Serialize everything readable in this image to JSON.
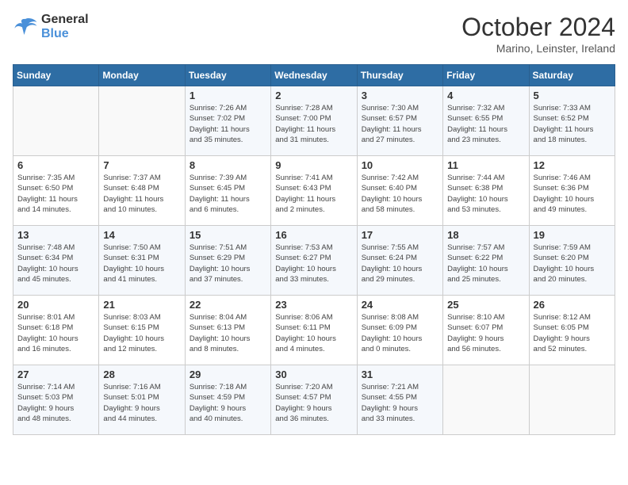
{
  "header": {
    "logo_line1": "General",
    "logo_line2": "Blue",
    "month": "October 2024",
    "location": "Marino, Leinster, Ireland"
  },
  "columns": [
    "Sunday",
    "Monday",
    "Tuesday",
    "Wednesday",
    "Thursday",
    "Friday",
    "Saturday"
  ],
  "rows": [
    [
      {
        "day": "",
        "info": ""
      },
      {
        "day": "",
        "info": ""
      },
      {
        "day": "1",
        "info": "Sunrise: 7:26 AM\nSunset: 7:02 PM\nDaylight: 11 hours\nand 35 minutes."
      },
      {
        "day": "2",
        "info": "Sunrise: 7:28 AM\nSunset: 7:00 PM\nDaylight: 11 hours\nand 31 minutes."
      },
      {
        "day": "3",
        "info": "Sunrise: 7:30 AM\nSunset: 6:57 PM\nDaylight: 11 hours\nand 27 minutes."
      },
      {
        "day": "4",
        "info": "Sunrise: 7:32 AM\nSunset: 6:55 PM\nDaylight: 11 hours\nand 23 minutes."
      },
      {
        "day": "5",
        "info": "Sunrise: 7:33 AM\nSunset: 6:52 PM\nDaylight: 11 hours\nand 18 minutes."
      }
    ],
    [
      {
        "day": "6",
        "info": "Sunrise: 7:35 AM\nSunset: 6:50 PM\nDaylight: 11 hours\nand 14 minutes."
      },
      {
        "day": "7",
        "info": "Sunrise: 7:37 AM\nSunset: 6:48 PM\nDaylight: 11 hours\nand 10 minutes."
      },
      {
        "day": "8",
        "info": "Sunrise: 7:39 AM\nSunset: 6:45 PM\nDaylight: 11 hours\nand 6 minutes."
      },
      {
        "day": "9",
        "info": "Sunrise: 7:41 AM\nSunset: 6:43 PM\nDaylight: 11 hours\nand 2 minutes."
      },
      {
        "day": "10",
        "info": "Sunrise: 7:42 AM\nSunset: 6:40 PM\nDaylight: 10 hours\nand 58 minutes."
      },
      {
        "day": "11",
        "info": "Sunrise: 7:44 AM\nSunset: 6:38 PM\nDaylight: 10 hours\nand 53 minutes."
      },
      {
        "day": "12",
        "info": "Sunrise: 7:46 AM\nSunset: 6:36 PM\nDaylight: 10 hours\nand 49 minutes."
      }
    ],
    [
      {
        "day": "13",
        "info": "Sunrise: 7:48 AM\nSunset: 6:34 PM\nDaylight: 10 hours\nand 45 minutes."
      },
      {
        "day": "14",
        "info": "Sunrise: 7:50 AM\nSunset: 6:31 PM\nDaylight: 10 hours\nand 41 minutes."
      },
      {
        "day": "15",
        "info": "Sunrise: 7:51 AM\nSunset: 6:29 PM\nDaylight: 10 hours\nand 37 minutes."
      },
      {
        "day": "16",
        "info": "Sunrise: 7:53 AM\nSunset: 6:27 PM\nDaylight: 10 hours\nand 33 minutes."
      },
      {
        "day": "17",
        "info": "Sunrise: 7:55 AM\nSunset: 6:24 PM\nDaylight: 10 hours\nand 29 minutes."
      },
      {
        "day": "18",
        "info": "Sunrise: 7:57 AM\nSunset: 6:22 PM\nDaylight: 10 hours\nand 25 minutes."
      },
      {
        "day": "19",
        "info": "Sunrise: 7:59 AM\nSunset: 6:20 PM\nDaylight: 10 hours\nand 20 minutes."
      }
    ],
    [
      {
        "day": "20",
        "info": "Sunrise: 8:01 AM\nSunset: 6:18 PM\nDaylight: 10 hours\nand 16 minutes."
      },
      {
        "day": "21",
        "info": "Sunrise: 8:03 AM\nSunset: 6:15 PM\nDaylight: 10 hours\nand 12 minutes."
      },
      {
        "day": "22",
        "info": "Sunrise: 8:04 AM\nSunset: 6:13 PM\nDaylight: 10 hours\nand 8 minutes."
      },
      {
        "day": "23",
        "info": "Sunrise: 8:06 AM\nSunset: 6:11 PM\nDaylight: 10 hours\nand 4 minutes."
      },
      {
        "day": "24",
        "info": "Sunrise: 8:08 AM\nSunset: 6:09 PM\nDaylight: 10 hours\nand 0 minutes."
      },
      {
        "day": "25",
        "info": "Sunrise: 8:10 AM\nSunset: 6:07 PM\nDaylight: 9 hours\nand 56 minutes."
      },
      {
        "day": "26",
        "info": "Sunrise: 8:12 AM\nSunset: 6:05 PM\nDaylight: 9 hours\nand 52 minutes."
      }
    ],
    [
      {
        "day": "27",
        "info": "Sunrise: 7:14 AM\nSunset: 5:03 PM\nDaylight: 9 hours\nand 48 minutes."
      },
      {
        "day": "28",
        "info": "Sunrise: 7:16 AM\nSunset: 5:01 PM\nDaylight: 9 hours\nand 44 minutes."
      },
      {
        "day": "29",
        "info": "Sunrise: 7:18 AM\nSunset: 4:59 PM\nDaylight: 9 hours\nand 40 minutes."
      },
      {
        "day": "30",
        "info": "Sunrise: 7:20 AM\nSunset: 4:57 PM\nDaylight: 9 hours\nand 36 minutes."
      },
      {
        "day": "31",
        "info": "Sunrise: 7:21 AM\nSunset: 4:55 PM\nDaylight: 9 hours\nand 33 minutes."
      },
      {
        "day": "",
        "info": ""
      },
      {
        "day": "",
        "info": ""
      }
    ]
  ]
}
